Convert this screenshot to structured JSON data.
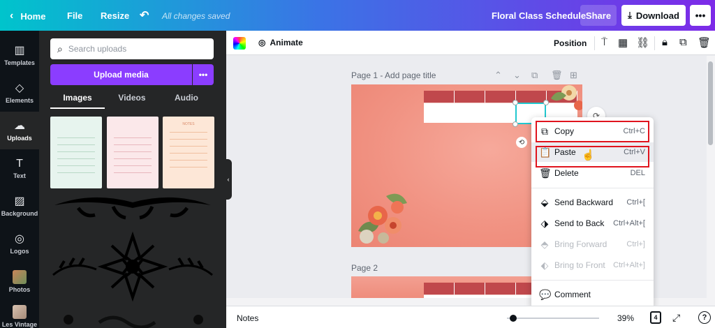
{
  "topbar": {
    "home": "Home",
    "file": "File",
    "resize": "Resize",
    "saved_status": "All changes saved",
    "title": "Floral Class Schedule",
    "share": "Share",
    "download": "Download",
    "more": "•••"
  },
  "rail": {
    "items": [
      {
        "label": "Templates",
        "icon": "▥"
      },
      {
        "label": "Elements",
        "icon": "◇"
      },
      {
        "label": "Uploads",
        "icon": "☁"
      },
      {
        "label": "Text",
        "icon": "T"
      },
      {
        "label": "Background",
        "icon": "▨"
      },
      {
        "label": "Logos",
        "icon": "◎"
      },
      {
        "label": "Photos",
        "icon": ""
      },
      {
        "label": "Les Vintage",
        "icon": ""
      }
    ]
  },
  "panel": {
    "search_placeholder": "Search uploads",
    "upload_button": "Upload media",
    "upload_more": "•••",
    "tabs": [
      "Images",
      "Videos",
      "Audio"
    ],
    "thumb3_title": "NOTES"
  },
  "editor_toolbar": {
    "animate": "Animate",
    "position": "Position"
  },
  "canvas": {
    "page1_label": "Page 1 - Add page title",
    "page2_label": "Page 2"
  },
  "context_menu": {
    "items": [
      {
        "label": "Copy",
        "shortcut": "Ctrl+C",
        "icon": "⧉"
      },
      {
        "label": "Paste",
        "shortcut": "Ctrl+V",
        "icon": "📋"
      },
      {
        "label": "Delete",
        "shortcut": "DEL",
        "icon": "🗑"
      },
      {
        "label": "Send Backward",
        "shortcut": "Ctrl+[",
        "icon": "⬙"
      },
      {
        "label": "Send to Back",
        "shortcut": "Ctrl+Alt+[",
        "icon": "⬗"
      },
      {
        "label": "Bring Forward",
        "shortcut": "Ctrl+]",
        "icon": "⬘"
      },
      {
        "label": "Bring to Front",
        "shortcut": "Ctrl+Alt+]",
        "icon": "⬖"
      },
      {
        "label": "Comment",
        "shortcut": "",
        "icon": "💬"
      }
    ]
  },
  "footer": {
    "notes": "Notes",
    "zoom": "39%",
    "page_count": "4",
    "help": "?"
  },
  "colors": {
    "brand_purple": "#8b3dff",
    "highlight_red": "#e0141e",
    "table_header": "#c0484c",
    "selection": "#21c8cf"
  }
}
